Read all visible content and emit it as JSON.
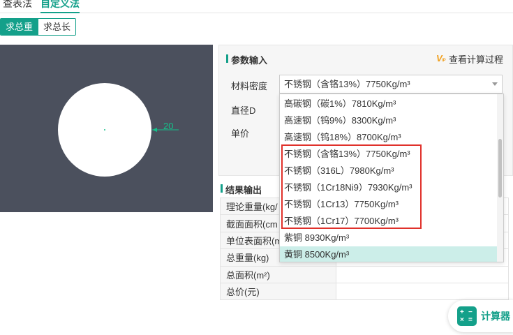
{
  "top_tabs": [
    {
      "label": "查表法"
    },
    {
      "label": "自定义法"
    }
  ],
  "mode_buttons": [
    {
      "label": "求总重"
    },
    {
      "label": "求总长"
    }
  ],
  "preview": {
    "dimension_value": "20"
  },
  "params": {
    "title": "参数输入",
    "view_process": "查看计算过程",
    "density_label": "材料密度",
    "diameter_label": "直径D",
    "price_label": "单价",
    "density_selected": "不锈钢（含铬13%）7750Kg/m³"
  },
  "dropdown": {
    "items": [
      {
        "label": "高碳钢（碳1%）7810Kg/m³"
      },
      {
        "label": "高速钢（钨9%）8300Kg/m³"
      },
      {
        "label": "高速钢（钨18%）8700Kg/m³"
      },
      {
        "label": "不锈钢（含铬13%）7750Kg/m³"
      },
      {
        "label": "不锈钢（316L）7980Kg/m³"
      },
      {
        "label": "不锈钢（1Cr18Ni9）7930Kg/m³"
      },
      {
        "label": "不锈钢（1Cr13）7750Kg/m³"
      },
      {
        "label": "不锈钢（1Cr17）7700Kg/m³"
      },
      {
        "label": "紫铜 8930Kg/m³"
      },
      {
        "label": "黄铜 8500Kg/m³"
      }
    ],
    "hovered_index": 9
  },
  "results": {
    "title": "结果输出",
    "rows": [
      {
        "label": "理论重量(kg/",
        "value": ""
      },
      {
        "label": "截面面积(cm",
        "value": ""
      },
      {
        "label": "单位表面积(m",
        "value": ""
      },
      {
        "label": "总重量(kg)",
        "value": ""
      },
      {
        "label": "总面积(m²)",
        "value": ""
      },
      {
        "label": "总价(元)",
        "value": ""
      }
    ]
  },
  "calculator": {
    "label": "计算器"
  },
  "colors": {
    "accent": "#14a08a",
    "highlight": "#e0312b",
    "preview_bg": "#4b505d"
  }
}
